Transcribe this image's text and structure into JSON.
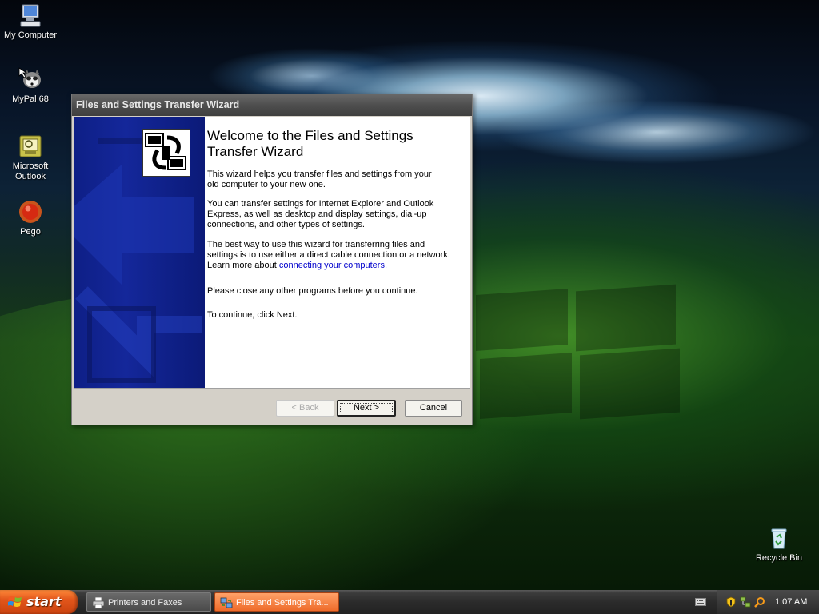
{
  "desktop": {
    "icons": [
      {
        "label": "My Computer"
      },
      {
        "label": "MyPal 68"
      },
      {
        "label": "Microsoft Outlook"
      },
      {
        "label": "Pego"
      },
      {
        "label": "Recycle Bin"
      }
    ]
  },
  "wizard": {
    "title": "Files and Settings Transfer Wizard",
    "heading": "Welcome to the Files and Settings Transfer Wizard",
    "para1": "This wizard helps you transfer files and settings from your old computer to your new one.",
    "para2": "You can transfer settings for Internet Explorer and Outlook Express, as well as desktop and display settings, dial-up connections, and other types of settings.",
    "para3_pre": "The best way to use this wizard for transferring files and settings is to use either a direct cable connection or a network. Learn more about ",
    "para3_link": "connecting your computers.",
    "para4": "Please close any other programs before you continue.",
    "para5": "To continue, click Next.",
    "buttons": {
      "back": "< Back",
      "next": "Next >",
      "cancel": "Cancel"
    }
  },
  "taskbar": {
    "start_label": "start",
    "tasks": [
      {
        "label": "Printers and Faxes"
      },
      {
        "label": "Files and Settings Tra..."
      }
    ],
    "clock": "1:07 AM"
  },
  "colors": {
    "wizard_side_blue": "#14279a",
    "start_orange": "#e2561b",
    "active_task_orange": "#ee6b2a",
    "link_blue": "#0000cc"
  }
}
